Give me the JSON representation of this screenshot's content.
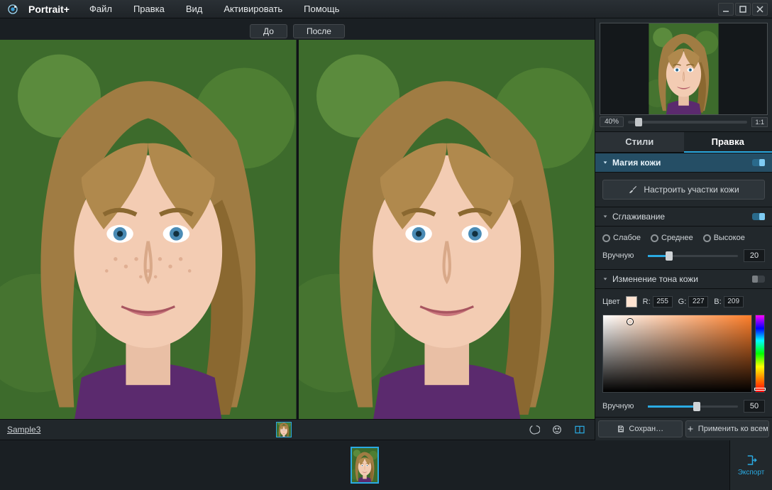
{
  "app": {
    "title": "Portrait+"
  },
  "menu": {
    "file": "Файл",
    "edit": "Правка",
    "view": "Вид",
    "activate": "Активировать",
    "help": "Помощь"
  },
  "viewer": {
    "before": "До",
    "after": "После",
    "sample_name": "Sample3"
  },
  "preview": {
    "zoom": "40%",
    "fit": "1:1"
  },
  "tabs": {
    "styles": "Стили",
    "edit": "Правка"
  },
  "sections": {
    "skin_magic": {
      "title": "Магия кожи",
      "adjust_skin_areas": "Настроить участки кожи"
    },
    "smoothing": {
      "title": "Сглаживание",
      "options": {
        "weak": "Слабое",
        "medium": "Среднее",
        "high": "Высокое"
      },
      "manual_label": "Вручную",
      "manual_value": "20"
    },
    "skin_tone": {
      "title": "Изменение тона кожи",
      "color_label": "Цвет",
      "swatch_hex": "#ffe3d1",
      "r_label": "R:",
      "r": "255",
      "g_label": "G:",
      "g": "227",
      "b_label": "B:",
      "b": "209",
      "manual_label": "Вручную",
      "manual_value": "50"
    }
  },
  "actions": {
    "save": "Сохран…",
    "apply_all": "Применить ко всем",
    "export": "Экспорт"
  },
  "icons": {
    "compare": "compare-icon",
    "face": "face-detect-icon",
    "split": "split-view-icon",
    "save": "floppy-icon",
    "plus": "plus-icon",
    "brush": "brush-icon",
    "export": "export-icon"
  }
}
